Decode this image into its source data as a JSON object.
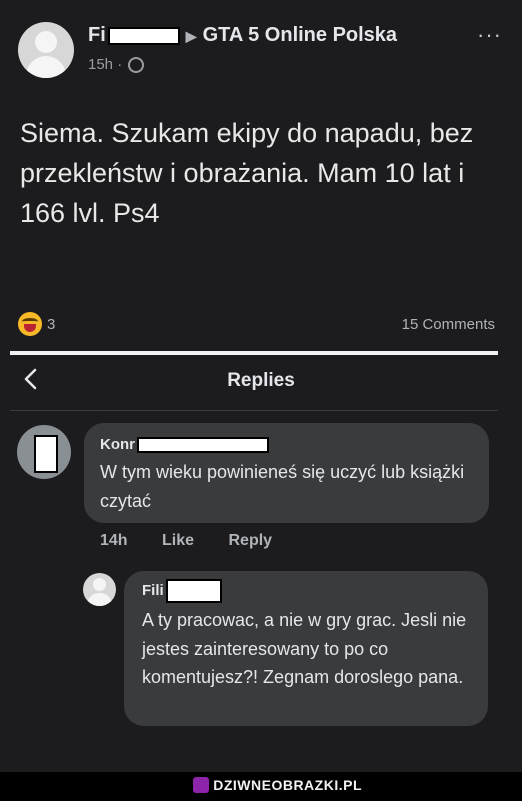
{
  "post": {
    "author_prefix": "Fi",
    "separator_icon": "triangle-right-icon",
    "group": "GTA 5 Online Polska",
    "time": "15h",
    "meta_sep": "·",
    "privacy_icon": "globe-icon",
    "more_label": "···",
    "text": "Siema. Szukam ekipy do napadu, bez przekleństw i obrażania. Mam 10 lat i 166 lvl. Ps4",
    "reaction_icon": "haha-emoji-icon",
    "reaction_count": "3",
    "comments_count": "15 Comments"
  },
  "replies_header": {
    "back_icon": "chevron-left-icon",
    "title": "Replies"
  },
  "comments": [
    {
      "author_prefix": "Konr",
      "text": "W tym wieku powinieneś się uczyć lub książki czytać",
      "time": "14h",
      "like": "Like",
      "reply": "Reply"
    },
    {
      "author_prefix": "Fili",
      "text": "A ty pracowac, a nie w gry grac. Jesli nie jestes zainteresowany to po co komentujesz?! Zegnam doroslego pana."
    }
  ],
  "watermark": {
    "text": "DZIWNEOBRAZKI.PL",
    "icon_color": "#8e24aa"
  },
  "colors": {
    "background": "#1c1c1e",
    "bubble": "#3a3b3c",
    "text": "#e4e6eb",
    "muted": "#b0b3b8"
  }
}
